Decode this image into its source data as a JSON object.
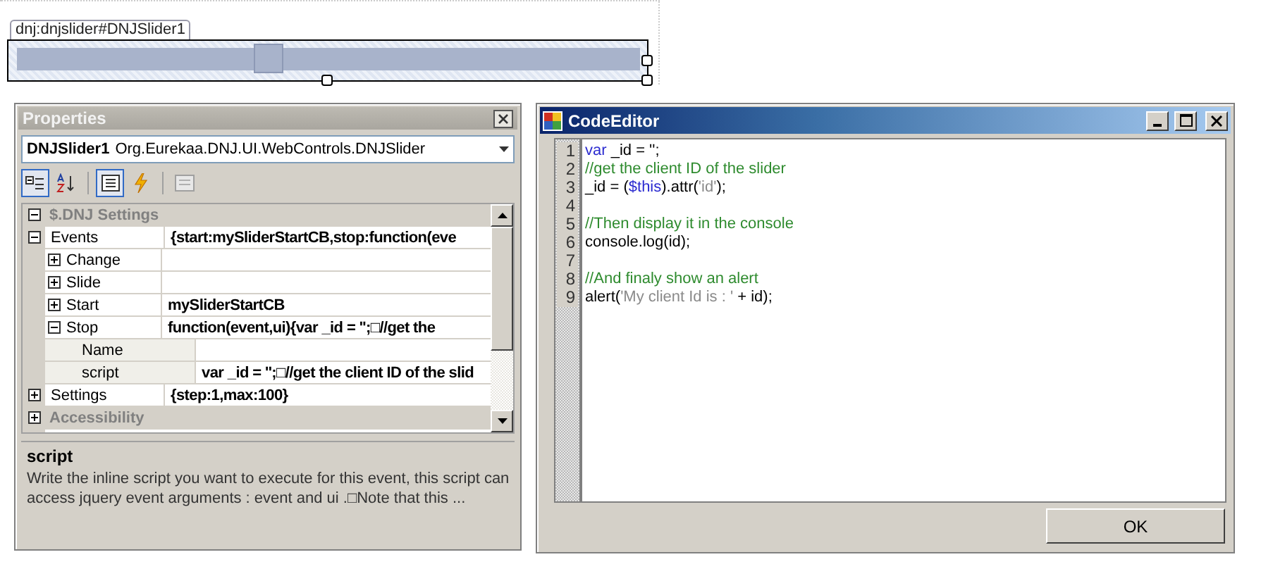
{
  "designer": {
    "tag": "dnj:dnjslider#DNJSlider1",
    "slider": {
      "level": 0.4
    }
  },
  "properties": {
    "title": "Properties",
    "object_name": "DNJSlider1",
    "object_type": "Org.Eurekaa.DNJ.UI.WebControls.DNJSlider",
    "toolbar": [
      {
        "kind": "categorized",
        "selected": true
      },
      {
        "kind": "alphabetical",
        "selected": false
      },
      {
        "kind": "properties",
        "selected": true
      },
      {
        "kind": "events",
        "selected": false
      },
      {
        "kind": "pages",
        "selected": false
      }
    ],
    "grid": [
      {
        "kind": "category",
        "label": "$.DNJ Settings",
        "expanded": true,
        "children": [
          {
            "label": "Events",
            "value": "{start:mySliderStartCB,stop:function(eve",
            "expanded": true,
            "children": [
              {
                "label": "Change",
                "expanded": false
              },
              {
                "label": "Slide",
                "expanded": false
              },
              {
                "label": "Start",
                "value": "mySliderStartCB",
                "expanded": false
              },
              {
                "label": "Stop",
                "value": "function(event,ui){var _id = '';□//get the",
                "expanded": true,
                "children": [
                  {
                    "label": "Name"
                  },
                  {
                    "label": "script",
                    "value": "var _id = '';□//get the client ID of the slid"
                  }
                ]
              }
            ]
          },
          {
            "label": "Settings",
            "value": "{step:1,max:100}",
            "expanded": false
          }
        ]
      },
      {
        "kind": "category",
        "label": "Accessibility",
        "expanded": false
      }
    ],
    "description": {
      "title": "script",
      "text": "Write the inline script you want to execute for this event, this script can access jquery event arguments : event and ui .□Note that this ..."
    }
  },
  "code_editor": {
    "title": "CodeEditor",
    "lines": [
      {
        "number": "1",
        "tokens": [
          {
            "kind": "keyword",
            "text": "var"
          },
          {
            "kind": "plain",
            "text": " _id = '';"
          }
        ]
      },
      {
        "number": "2",
        "tokens": [
          {
            "kind": "comment",
            "text": "//get the client ID of the slider"
          }
        ]
      },
      {
        "number": "3",
        "tokens": [
          {
            "kind": "plain",
            "text": "_id = ("
          },
          {
            "kind": "keyword",
            "text": "$this"
          },
          {
            "kind": "plain",
            "text": ").attr("
          },
          {
            "kind": "string",
            "text": "'id'"
          },
          {
            "kind": "plain",
            "text": ");"
          }
        ]
      },
      {
        "number": "4"
      },
      {
        "number": "5",
        "tokens": [
          {
            "kind": "comment",
            "text": "//Then display it in the console"
          }
        ]
      },
      {
        "number": "6",
        "tokens": [
          {
            "kind": "plain",
            "text": "console.log(id);"
          }
        ]
      },
      {
        "number": "7"
      },
      {
        "number": "8",
        "tokens": [
          {
            "kind": "comment",
            "text": "//And finaly show an alert"
          }
        ]
      },
      {
        "number": "9",
        "tokens": [
          {
            "kind": "plain",
            "text": "alert("
          },
          {
            "kind": "string",
            "text": "'My client Id is : '"
          },
          {
            "kind": "plain",
            "text": " + id);"
          }
        ]
      }
    ],
    "ok_button": "OK"
  }
}
